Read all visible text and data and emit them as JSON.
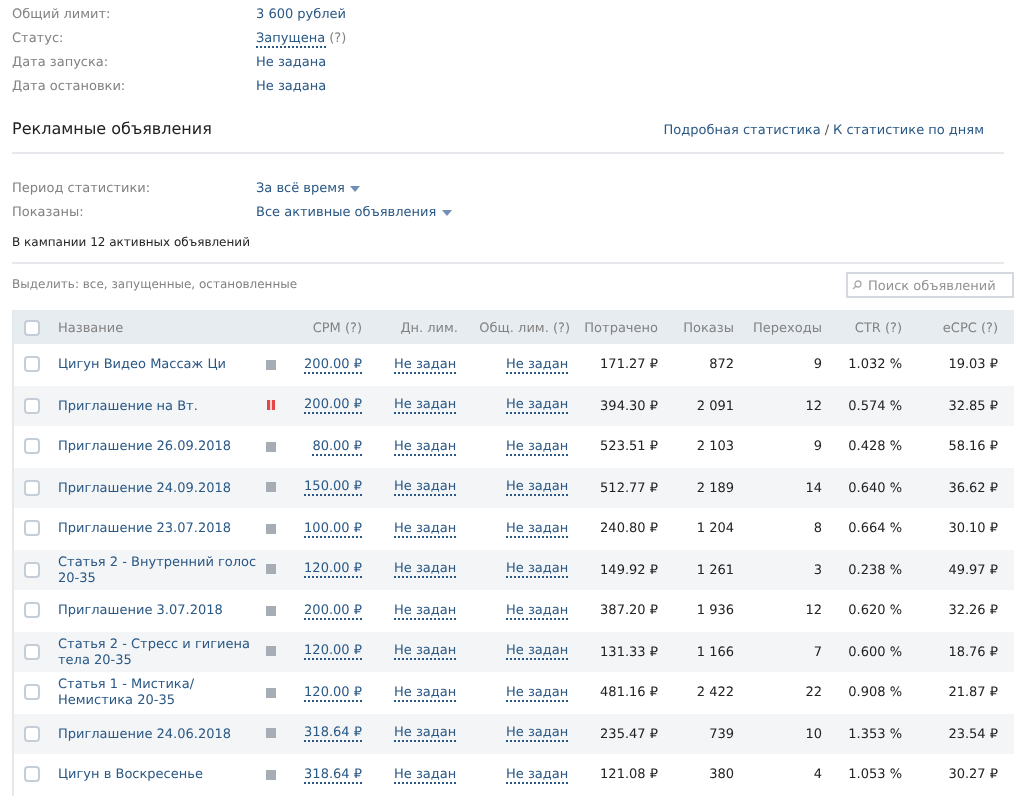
{
  "info": [
    {
      "label": "Общий лимит:",
      "value": "3 600 рублей",
      "kind": "text"
    },
    {
      "label": "Статус:",
      "value": "Запущена",
      "hint": "(?)",
      "kind": "link"
    },
    {
      "label": "Дата запуска:",
      "value": "Не задана",
      "kind": "text"
    },
    {
      "label": "Дата остановки:",
      "value": "Не задана",
      "kind": "text"
    }
  ],
  "section": {
    "title": "Рекламные объявления",
    "links": [
      "Подробная статистика",
      "К статистике по дням"
    ],
    "separator": "/"
  },
  "filters": [
    {
      "label": "Период статистики:",
      "value": "За всё время"
    },
    {
      "label": "Показаны:",
      "value": "Все активные объявления"
    }
  ],
  "summary": "В кампании 12 активных объявлений",
  "select": {
    "text": "Выделить: все, запущенные, остановленные"
  },
  "search": {
    "placeholder": "Поиск объявлений"
  },
  "table": {
    "select_all": {
      "checked": false
    },
    "columns": [
      "Название",
      "CPM (?)",
      "Дн. лим.",
      "Общ. лим. (?)",
      "Потрачено",
      "Показы",
      "Переходы",
      "CTR (?)",
      "eCPC (?)"
    ],
    "rows": [
      {
        "checked": false,
        "name": "Цигун Видео Массаж Ци",
        "kind": "running",
        "cpm": "200.00 ₽",
        "day_limit": "Не задан",
        "total_limit": "Не задан",
        "spent": "171.27 ₽",
        "views": "872",
        "clicks": "9",
        "ctr": "1.032 %",
        "ecpc": "19.03 ₽"
      },
      {
        "checked": false,
        "name": "Приглашение на Вт.",
        "kind": "paused",
        "cpm": "200.00 ₽",
        "day_limit": "Не задан",
        "total_limit": "Не задан",
        "spent": "394.30 ₽",
        "views": "2 091",
        "clicks": "12",
        "ctr": "0.574 %",
        "ecpc": "32.85 ₽"
      },
      {
        "checked": false,
        "name": "Приглашение 26.09.2018",
        "kind": "running",
        "cpm": "80.00 ₽",
        "day_limit": "Не задан",
        "total_limit": "Не задан",
        "spent": "523.51 ₽",
        "views": "2 103",
        "clicks": "9",
        "ctr": "0.428 %",
        "ecpc": "58.16 ₽"
      },
      {
        "checked": false,
        "name": "Приглашение 24.09.2018",
        "kind": "running",
        "cpm": "150.00 ₽",
        "day_limit": "Не задан",
        "total_limit": "Не задан",
        "spent": "512.77 ₽",
        "views": "2 189",
        "clicks": "14",
        "ctr": "0.640 %",
        "ecpc": "36.62 ₽"
      },
      {
        "checked": false,
        "name": "Приглашение 23.07.2018",
        "kind": "running",
        "cpm": "100.00 ₽",
        "day_limit": "Не задан",
        "total_limit": "Не задан",
        "spent": "240.80 ₽",
        "views": "1 204",
        "clicks": "8",
        "ctr": "0.664 %",
        "ecpc": "30.10 ₽"
      },
      {
        "checked": false,
        "name": "Статья 2 - Внутренний голос 20-35",
        "kind": "running",
        "cpm": "120.00 ₽",
        "day_limit": "Не задан",
        "total_limit": "Не задан",
        "spent": "149.92 ₽",
        "views": "1 261",
        "clicks": "3",
        "ctr": "0.238 %",
        "ecpc": "49.97 ₽"
      },
      {
        "checked": false,
        "name": "Приглашение 3.07.2018",
        "kind": "running",
        "cpm": "200.00 ₽",
        "day_limit": "Не задан",
        "total_limit": "Не задан",
        "spent": "387.20 ₽",
        "views": "1 936",
        "clicks": "12",
        "ctr": "0.620 %",
        "ecpc": "32.26 ₽"
      },
      {
        "checked": false,
        "name": "Статья 2 - Стресс и гигиена тела 20-35",
        "kind": "running",
        "cpm": "120.00 ₽",
        "day_limit": "Не задан",
        "total_limit": "Не задан",
        "spent": "131.33 ₽",
        "views": "1 166",
        "clicks": "7",
        "ctr": "0.600 %",
        "ecpc": "18.76 ₽"
      },
      {
        "checked": false,
        "name": "Статья 1 - Мистика/ Немистика 20-35",
        "kind": "running",
        "cpm": "120.00 ₽",
        "day_limit": "Не задан",
        "total_limit": "Не задан",
        "spent": "481.16 ₽",
        "views": "2 422",
        "clicks": "22",
        "ctr": "0.908 %",
        "ecpc": "21.87 ₽"
      },
      {
        "checked": false,
        "name": "Приглашение 24.06.2018",
        "kind": "running",
        "cpm": "318.64 ₽",
        "day_limit": "Не задан",
        "total_limit": "Не задан",
        "spent": "235.47 ₽",
        "views": "739",
        "clicks": "10",
        "ctr": "1.353 %",
        "ecpc": "23.54 ₽"
      },
      {
        "checked": false,
        "name": "Цигун в Воскресенье",
        "kind": "running",
        "cpm": "318.64 ₽",
        "day_limit": "Не задан",
        "total_limit": "Не задан",
        "spent": "121.08 ₽",
        "views": "380",
        "clicks": "4",
        "ctr": "1.053 %",
        "ecpc": "30.27 ₽"
      }
    ]
  }
}
